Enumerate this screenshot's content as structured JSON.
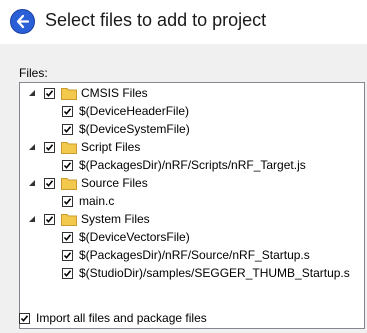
{
  "header": {
    "title": "Select files to add to project"
  },
  "files_label": "Files:",
  "tree": {
    "groups": [
      {
        "name": "CMSIS Files",
        "items": [
          "$(DeviceHeaderFile)",
          "$(DeviceSystemFile)"
        ]
      },
      {
        "name": "Script Files",
        "items": [
          "$(PackagesDir)/nRF/Scripts/nRF_Target.js"
        ]
      },
      {
        "name": "Source Files",
        "items": [
          "main.c"
        ]
      },
      {
        "name": "System Files",
        "items": [
          "$(DeviceVectorsFile)",
          "$(PackagesDir)/nRF/Source/nRF_Startup.s",
          "$(StudioDir)/samples/SEGGER_THUMB_Startup.s"
        ]
      }
    ]
  },
  "import_option": {
    "label": "Import all files and package files",
    "checked": true
  },
  "colors": {
    "back_button": "#2b5fd8",
    "folder": "#f2c94c",
    "panel_bg": "#f0f0f0"
  }
}
